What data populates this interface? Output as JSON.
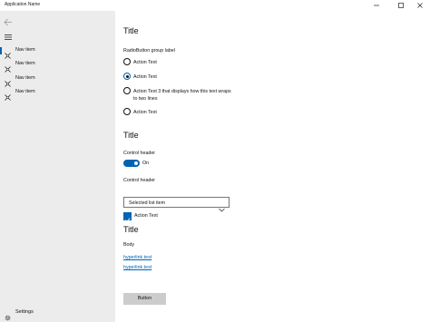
{
  "window": {
    "title": "Application Name",
    "controls": [
      "minimize-icon",
      "maximize-icon",
      "close-icon"
    ]
  },
  "nav": {
    "back_icon": "back-arrow-icon",
    "menu_icon": "hamburger-icon",
    "items": [
      {
        "label": "Nav item",
        "icon": "nav-glyph-icon",
        "selected": true
      },
      {
        "label": "Nav item",
        "icon": "nav-glyph-icon",
        "selected": false
      },
      {
        "label": "Nav item",
        "icon": "nav-glyph-icon",
        "selected": false
      },
      {
        "label": "Nav item",
        "icon": "nav-glyph-icon",
        "selected": false
      }
    ],
    "settings": {
      "label": "Settings",
      "icon": "gear-icon"
    }
  },
  "section1": {
    "title": "Title",
    "group_label": "RadioButton group label",
    "radios": [
      {
        "label": "Action Text",
        "checked": false
      },
      {
        "label": "Action Text",
        "checked": true
      },
      {
        "label": "Action Text 3 that displays how this text wraps to two lines",
        "checked": false
      },
      {
        "label": "Action Text",
        "checked": false
      }
    ]
  },
  "section2": {
    "title": "Title",
    "toggle_header": "Control header",
    "toggle_state": "On",
    "combo_header": "Control header",
    "combo_value": "Selected list item",
    "checkbox_label": "Action Text",
    "checkbox_checked": true
  },
  "section3": {
    "title": "Title",
    "body": "Body",
    "links": [
      "hyperlink text",
      "hyperlink text"
    ],
    "button_label": "Button"
  },
  "colors": {
    "accent": "#0063b1",
    "nav_background": "#ececec",
    "button_background": "#cccccc"
  }
}
